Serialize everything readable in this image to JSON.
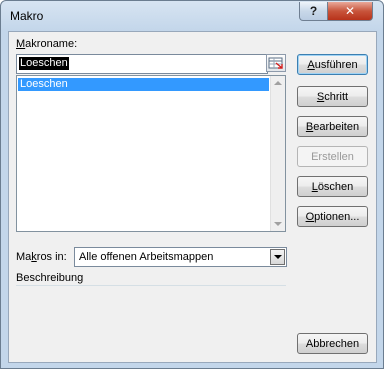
{
  "window": {
    "title": "Makro",
    "help": "?",
    "close": "✕"
  },
  "name_label": {
    "key": "M",
    "rest": "akroname:"
  },
  "name_value": "Loeschen",
  "macros": [
    {
      "label": "Loeschen"
    }
  ],
  "buttons": {
    "run": {
      "key": "A",
      "rest": "usführen"
    },
    "step": {
      "pre": "",
      "key": "S",
      "rest": "chritt"
    },
    "edit": {
      "key": "B",
      "rest": "earbeiten"
    },
    "create": {
      "label": "Erstellen"
    },
    "delete": {
      "key": "L",
      "rest": "öschen"
    },
    "options": {
      "key": "O",
      "rest": "ptionen..."
    },
    "cancel": {
      "label": "Abbrechen"
    }
  },
  "macros_in": {
    "pre": "Ma",
    "key": "k",
    "rest": "ros in:",
    "value": "Alle offenen Arbeitsmappen"
  },
  "description_label": "Beschreibung",
  "icons": {
    "ref": "range-select-icon",
    "dropdown": "chevron-down-icon"
  }
}
